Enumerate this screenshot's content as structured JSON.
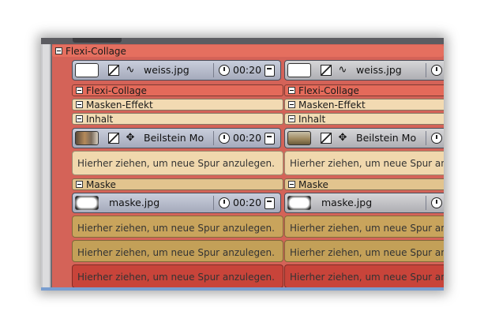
{
  "outer_group": {
    "label": "Flexi-Collage"
  },
  "top_clips": [
    {
      "file": "weiss.jpg",
      "duration": "00:20"
    },
    {
      "file": "weiss.jpg"
    }
  ],
  "columns": [
    {
      "flexi_label": "Flexi-Collage",
      "masken_label": "Masken-Effekt",
      "inhalt_label": "Inhalt",
      "inhalt_clip": {
        "file": "Beilstein Mo",
        "duration": "00:20"
      },
      "inhalt_drop": "Hierher ziehen, um neue Spur anzulegen.",
      "maske_label": "Maske",
      "maske_clip": {
        "file": "maske.jpg",
        "duration": "00:20"
      },
      "maske_drop": "Hierher ziehen, um neue Spur anzulegen.",
      "masken_drop": "Hierher ziehen, um neue Spur anzulegen.",
      "flexi_drop": "Hierher ziehen, um neue Spur anzulegen."
    },
    {
      "flexi_label": "Flexi-Collage",
      "masken_label": "Masken-Effekt",
      "inhalt_label": "Inhalt",
      "inhalt_clip": {
        "file": "Beilstein Mo"
      },
      "inhalt_drop": "Hierher ziehen, um neue Spur anzulegen.",
      "maske_label": "Maske",
      "maske_clip": {
        "file": "maske.jpg"
      },
      "maske_drop": "Hierher ziehen, um neue Spur anzulegen.",
      "masken_drop": "Hierher ziehen, um neue Spur anzulegen.",
      "flexi_drop": "Hierher ziehen, um neue Spur anzulegen."
    }
  ],
  "colors": {
    "flexi": "#e26b5c",
    "masken": "#f0d8b0",
    "inhalt": "#f2dcb4",
    "maske": "#e2c48e",
    "maske_drop": "#c9a45c",
    "masken_drop": "#c3a058",
    "flexi_drop": "#c8443a"
  }
}
